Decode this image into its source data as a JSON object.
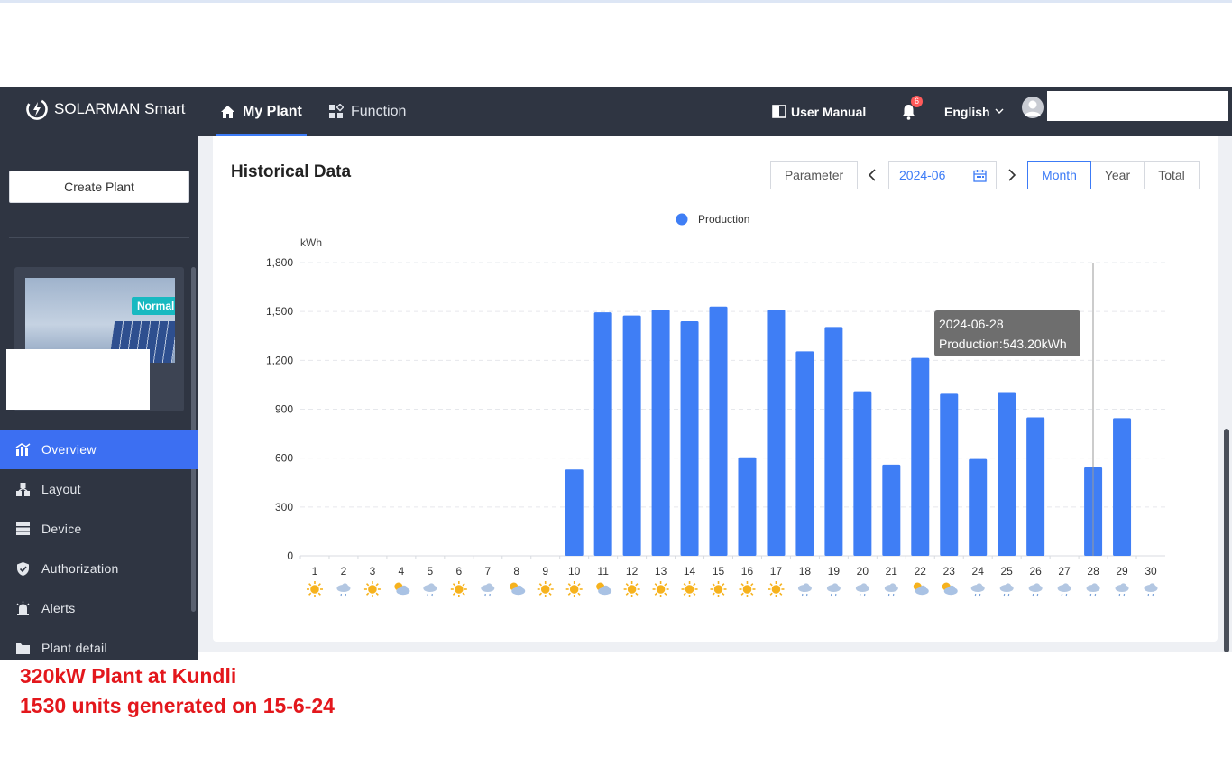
{
  "app": {
    "brand": "SOLARMAN Smart"
  },
  "nav": {
    "my_plant": "My Plant",
    "function": "Function",
    "user_manual": "User Manual",
    "notification_count": "6",
    "language": "English"
  },
  "sidebar": {
    "create_plant": "Create Plant",
    "plant_status": "Normal",
    "items": [
      {
        "label": "Overview",
        "icon": "chart-icon",
        "active": true
      },
      {
        "label": "Layout",
        "icon": "layout-icon",
        "active": false
      },
      {
        "label": "Device",
        "icon": "device-icon",
        "active": false
      },
      {
        "label": "Authorization",
        "icon": "shield-icon",
        "active": false
      },
      {
        "label": "Alerts",
        "icon": "alert-icon",
        "active": false
      },
      {
        "label": "Plant detail",
        "icon": "folder-icon",
        "active": false
      }
    ]
  },
  "panel": {
    "title": "Historical Data",
    "parameter_button": "Parameter",
    "date_value": "2024-06",
    "range_tabs": [
      "Month",
      "Year",
      "Total"
    ],
    "active_range": "Month"
  },
  "tooltip": {
    "date": "2024-06-28",
    "text": "Production:543.20kWh"
  },
  "chart_data": {
    "type": "bar",
    "legend": [
      "Production"
    ],
    "ylabel": "kWh",
    "ylim": [
      0,
      1800
    ],
    "yticks": [
      0,
      300,
      600,
      900,
      "1,200",
      "1,500",
      "1,800"
    ],
    "grid": true,
    "legend_position": "top-center",
    "categories": [
      "1",
      "2",
      "3",
      "4",
      "5",
      "6",
      "7",
      "8",
      "9",
      "10",
      "11",
      "12",
      "13",
      "14",
      "15",
      "16",
      "17",
      "18",
      "19",
      "20",
      "21",
      "22",
      "23",
      "24",
      "25",
      "26",
      "27",
      "28",
      "29",
      "30"
    ],
    "series": [
      {
        "name": "Production",
        "values": [
          0,
          0,
          0,
          0,
          0,
          0,
          0,
          0,
          0,
          530,
          1495,
          1475,
          1510,
          1440,
          1530,
          605,
          1510,
          1255,
          1405,
          1010,
          560,
          1215,
          995,
          595,
          1005,
          850,
          0,
          543.2,
          845,
          0
        ]
      }
    ],
    "weather": [
      "sunny",
      "rain",
      "sunny",
      "cloudy",
      "rain",
      "sunny",
      "rain",
      "cloudy",
      "sunny",
      "sunny",
      "cloudy",
      "sunny",
      "sunny",
      "sunny",
      "sunny",
      "sunny",
      "sunny",
      "rain",
      "rain",
      "rain",
      "rain",
      "cloudy",
      "cloudy",
      "rain",
      "rain",
      "rain",
      "rain",
      "rain",
      "rain",
      "rain"
    ],
    "colors": {
      "bar": "#3f7ef5",
      "grid": "#e6e8ec",
      "axis": "#d8dbe0"
    }
  },
  "annotation": {
    "line1": "320kW Plant at Kundli",
    "line2": "1530 units generated on 15-6-24"
  }
}
